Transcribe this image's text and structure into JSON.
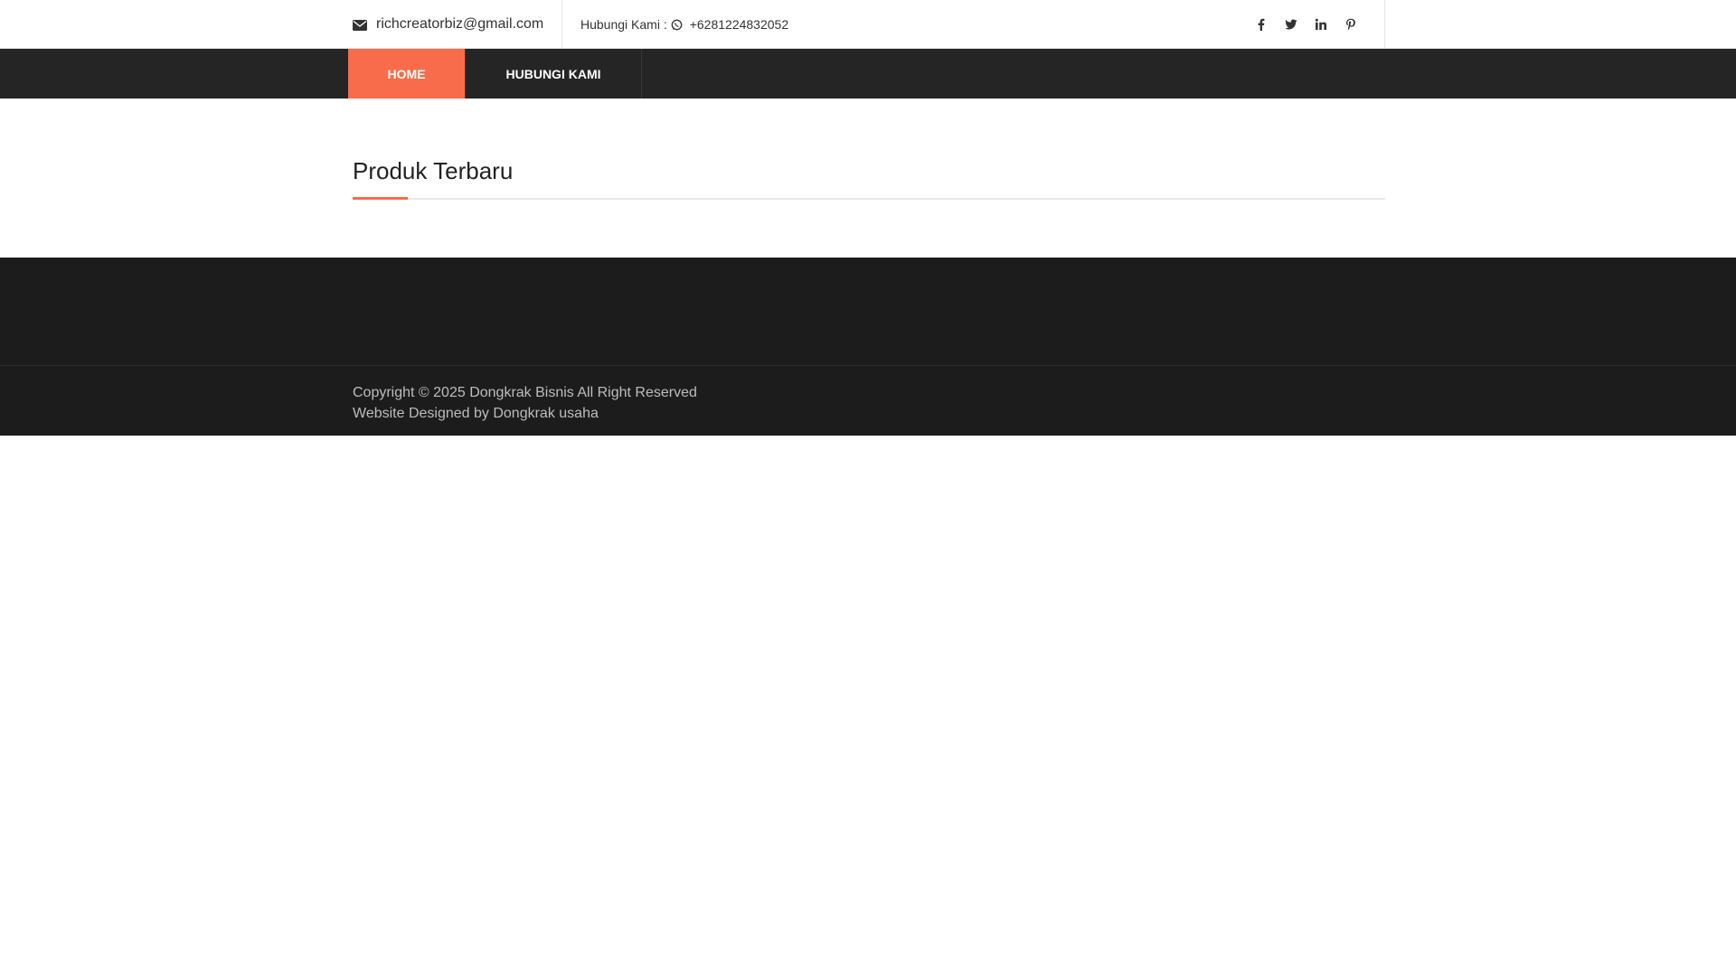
{
  "topbar": {
    "email_icon": "envelope-icon",
    "email": "richcreatorbiz@gmail.com",
    "contact_label": "Hubungi Kami :",
    "whatsapp_icon": "whatsapp-icon",
    "phone": "+6281224832052",
    "social": [
      "facebook-icon",
      "twitter-icon",
      "linkedin-icon",
      "pinterest-icon"
    ]
  },
  "nav": {
    "items": [
      {
        "label": "HOME",
        "active": true
      },
      {
        "label": "HUBUNGI KAMI",
        "active": false
      }
    ],
    "active_color": "#f96c4b",
    "bar_color": "#252525"
  },
  "main": {
    "section_title": "Produk Terbaru",
    "accent_color": "#f96c4b"
  },
  "footer": {
    "copyright": "Copyright © 2025 Dongkrak Bisnis All Right Reserved",
    "designed_by": "Website Designed by Dongkrak usaha",
    "bg_color": "#1c1c1c"
  }
}
